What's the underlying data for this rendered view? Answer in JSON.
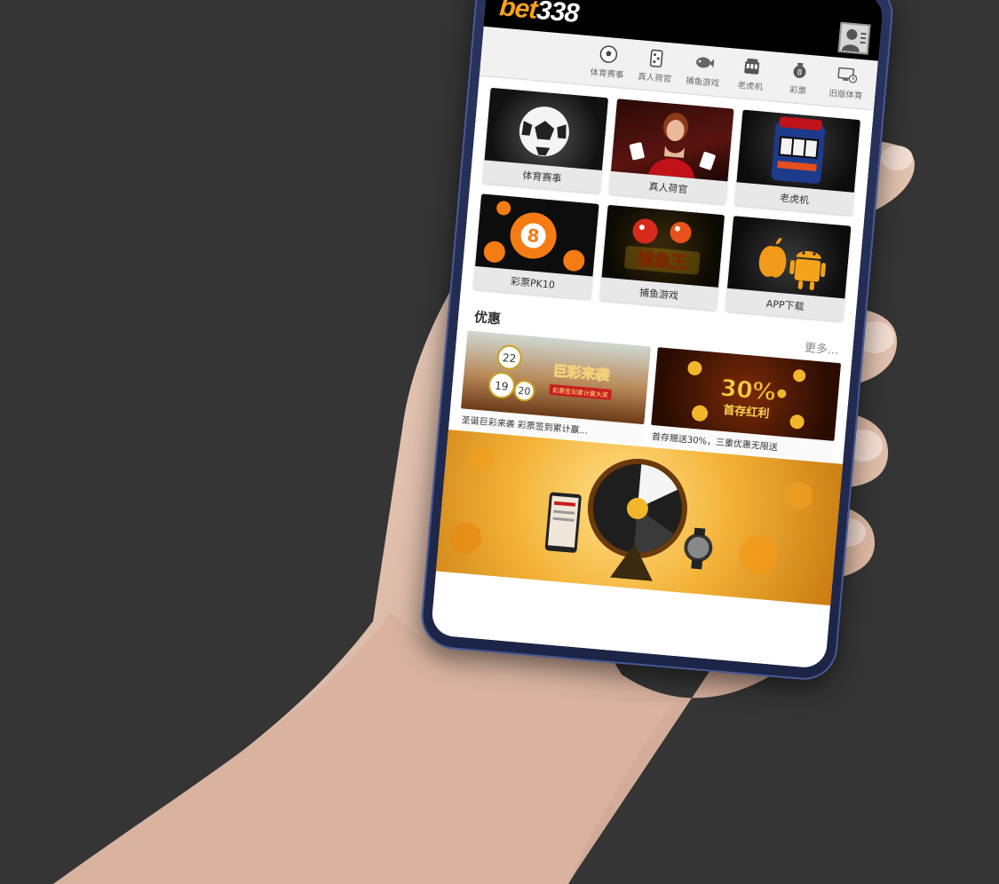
{
  "app": {
    "logo_bet": "bet",
    "logo_num": "338"
  },
  "nav": [
    {
      "label": "体育赛事",
      "icon": "soccer-ball-icon"
    },
    {
      "label": "真人荷官",
      "icon": "poker-chips-icon"
    },
    {
      "label": "捕鱼游戏",
      "icon": "fish-icon"
    },
    {
      "label": "老虎机",
      "icon": "slot-machine-icon"
    },
    {
      "label": "彩票",
      "icon": "lottery-ball-icon"
    },
    {
      "label": "旧版体育",
      "icon": "monitor-clock-icon"
    }
  ],
  "games": [
    {
      "label": "体育赛事"
    },
    {
      "label": "真人荷官"
    },
    {
      "label": "老虎机"
    },
    {
      "label": "彩票PK10"
    },
    {
      "label": "捕鱼游戏"
    },
    {
      "label": "APP下载"
    }
  ],
  "promos": {
    "title": "优惠",
    "more": "更多...",
    "items": [
      {
        "caption": "圣诞巨彩来袭 彩票签到累计赢...",
        "art_title": "巨彩来袭",
        "art_sub": "彩票签到累计赢大奖"
      },
      {
        "caption": "首存赠送30%，三重优惠无限送",
        "art_title": "30%",
        "art_sub": "首存红利"
      }
    ]
  },
  "tile_art": {
    "lottery_number": "8",
    "fish_title": "捕鱼王",
    "balls": [
      "22",
      "19",
      "20"
    ]
  },
  "colors": {
    "brand_orange": "#f6a21a",
    "screen_bg": "#000000",
    "nav_bg": "#f1f1f1"
  }
}
